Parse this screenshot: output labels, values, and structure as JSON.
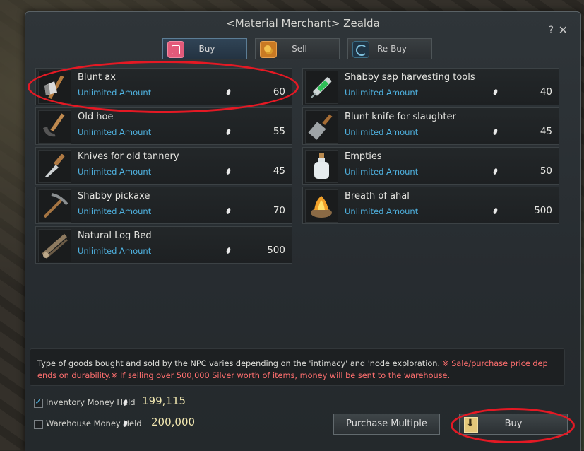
{
  "window": {
    "title": "<Material Merchant> Zealda",
    "help": "?",
    "close": "✕"
  },
  "tabs": [
    {
      "label": "Buy",
      "icon": "shopping-bag-icon",
      "active": true
    },
    {
      "label": "Sell",
      "icon": "coins-icon",
      "active": false
    },
    {
      "label": "Re-Buy",
      "icon": "circular-arrow-icon",
      "active": false
    }
  ],
  "items": [
    {
      "name": "Blunt ax",
      "amount": "Unlimited Amount",
      "price": "60",
      "icon": "axe-icon"
    },
    {
      "name": "Shabby sap harvesting tools",
      "amount": "Unlimited Amount",
      "price": "40",
      "icon": "syringe-icon"
    },
    {
      "name": "Old hoe",
      "amount": "Unlimited Amount",
      "price": "55",
      "icon": "hoe-icon"
    },
    {
      "name": "Blunt knife for slaughter",
      "amount": "Unlimited Amount",
      "price": "45",
      "icon": "cleaver-icon"
    },
    {
      "name": "Knives for old tannery",
      "amount": "Unlimited Amount",
      "price": "45",
      "icon": "knife-icon"
    },
    {
      "name": "Empties",
      "amount": "Unlimited Amount",
      "price": "50",
      "icon": "bottle-icon"
    },
    {
      "name": "Shabby pickaxe",
      "amount": "Unlimited Amount",
      "price": "70",
      "icon": "pickaxe-icon"
    },
    {
      "name": "Breath of ahal",
      "amount": "Unlimited Amount",
      "price": "500",
      "icon": "fire-bowl-icon"
    },
    {
      "name": "Natural Log Bed",
      "amount": "Unlimited Amount",
      "price": "500",
      "icon": "log-bed-icon"
    }
  ],
  "notice": {
    "text": "Type of goods bought and sold by the NPC varies depending on the 'intimacy' and 'node exploration.'",
    "warning": "※ Sale/purchase price dep ends on durability.※ If selling over 500,000 Silver worth of items, money will be sent to the warehouse."
  },
  "money": {
    "inventory_label": "Inventory Money Held",
    "inventory_value": "199,115",
    "inventory_checked": true,
    "warehouse_label": "Warehouse Money Held",
    "warehouse_value": "200,000",
    "warehouse_checked": false
  },
  "buttons": {
    "purchase_multiple": "Purchase Multiple",
    "buy": "Buy"
  },
  "colors": {
    "accent": "#4fb2e0",
    "warning": "#ff6f6f",
    "annotation": "#e41924"
  }
}
